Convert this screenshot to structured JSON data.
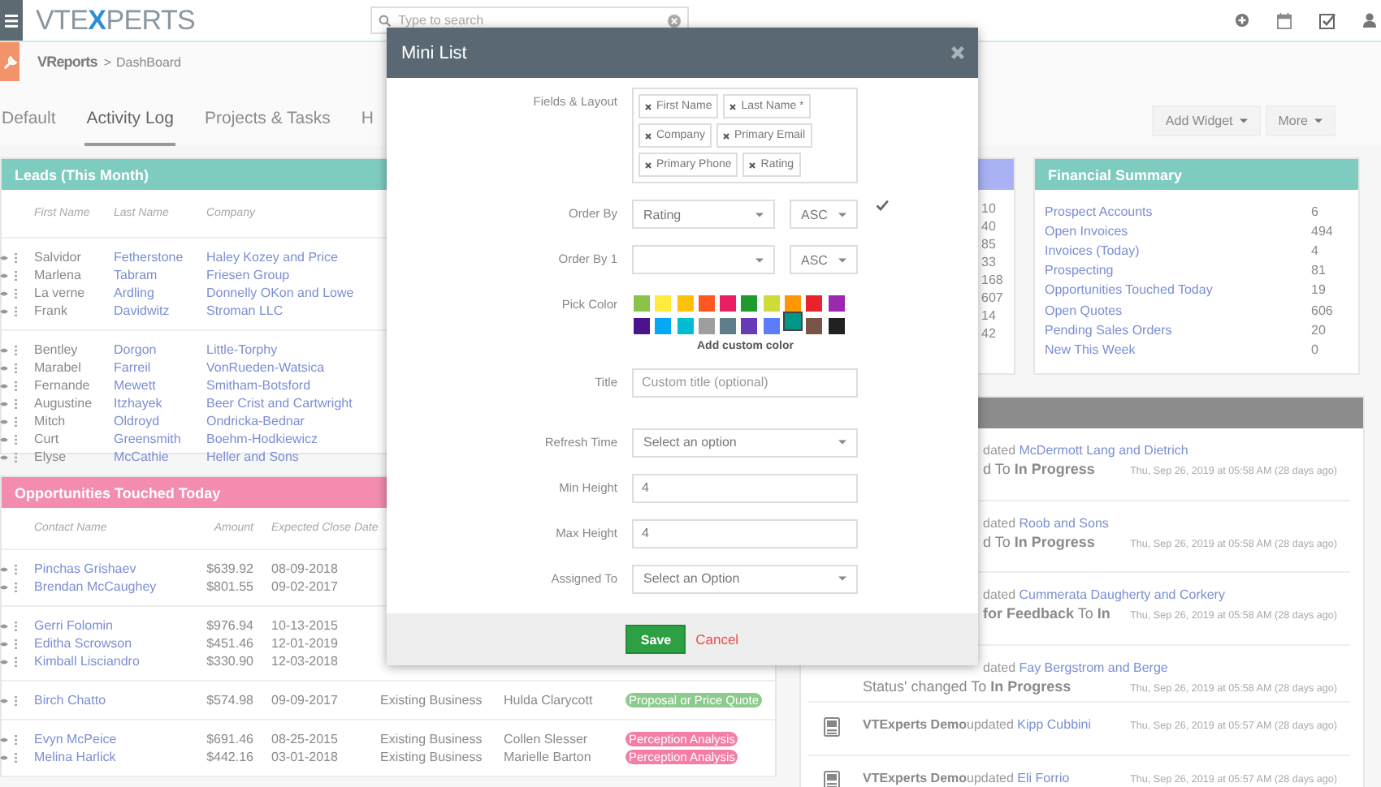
{
  "topbar": {
    "logo": [
      "VTE",
      "X",
      "PERTS"
    ],
    "search": {
      "placeholder": "Type to search"
    }
  },
  "breadcrumb": {
    "app": "VReports",
    "separator": ">",
    "page": "DashBoard"
  },
  "tabs": [
    {
      "label": "Default",
      "selected": false
    },
    {
      "label": "Activity Log",
      "selected": true
    },
    {
      "label": "Projects & Tasks",
      "selected": false
    },
    {
      "label": "H",
      "selected": false
    }
  ],
  "actions": [
    "Add Widget",
    "More"
  ],
  "leads": {
    "title": "Leads (This Month)",
    "columns": [
      "First Name",
      "Last Name",
      "Company"
    ],
    "groups": [
      [
        {
          "first": "Salvidor",
          "last": "Fetherstone",
          "company": "Haley Kozey and Price"
        },
        {
          "first": "Marlena",
          "last": "Tabram",
          "company": "Friesen Group"
        },
        {
          "first": "La verne",
          "last": "Ardling",
          "company": "Donnelly OKon and Lowe"
        },
        {
          "first": "Frank",
          "last": "Davidwitz",
          "company": "Stroman LLC"
        }
      ],
      [
        {
          "first": "Bentley",
          "last": "Dorgon",
          "company": "Little-Torphy"
        },
        {
          "first": "Marabel",
          "last": "Farreil",
          "company": "VonRueden-Watsica"
        },
        {
          "first": "Fernande",
          "last": "Mewett",
          "company": "Smitham-Botsford"
        },
        {
          "first": "Augustine",
          "last": "Itzhayek",
          "company": "Beer Crist and Cartwright"
        },
        {
          "first": "Mitch",
          "last": "Oldroyd",
          "company": "Ondricka-Bednar"
        },
        {
          "first": "Curt",
          "last": "Greensmith",
          "company": "Boehm-Hodkiewicz"
        },
        {
          "first": "Elyse",
          "last": "McCathie",
          "company": "Heller and Sons"
        }
      ]
    ]
  },
  "counts": [
    "10",
    "40",
    "85",
    "33",
    "168",
    "607",
    "14",
    "42"
  ],
  "financial": {
    "title": "Financial Summary",
    "rows": [
      {
        "label": "Prospect Accounts",
        "value": "6"
      },
      {
        "label": "Open Invoices",
        "value": "494"
      },
      {
        "label": "Invoices (Today)",
        "value": "4"
      },
      {
        "label": "Prospecting",
        "value": "81"
      },
      {
        "label": "Opportunities Touched Today",
        "value": "19"
      },
      {
        "label": "Open Quotes",
        "value": "606"
      },
      {
        "label": "Pending Sales Orders",
        "value": "20"
      },
      {
        "label": "New This Week",
        "value": "0"
      }
    ]
  },
  "opportunities": {
    "title": "Opportunities Touched Today",
    "columns": [
      "Contact Name",
      "Amount",
      "Expected Close Date"
    ],
    "groups": [
      [
        {
          "contact": "Pinchas Grishaev",
          "amount": "$639.92",
          "date": "08-09-2018"
        },
        {
          "contact": "Brendan McCaughey",
          "amount": "$801.55",
          "date": "09-02-2017"
        }
      ],
      [
        {
          "contact": "Gerri Folomin",
          "amount": "$976.94",
          "date": "10-13-2015"
        },
        {
          "contact": "Editha Scrowson",
          "amount": "$451.46",
          "date": "12-01-2019"
        },
        {
          "contact": "Kimball Lisciandro",
          "amount": "$330.90",
          "date": "12-03-2018"
        }
      ],
      [
        {
          "contact": "Birch Chatto",
          "amount": "$574.98",
          "date": "09-09-2017",
          "type": "Existing Business",
          "owner": "Hulda Clarycott",
          "stage": "Proposal or Price Quote",
          "color": "#8ccb8c"
        }
      ],
      [
        {
          "contact": "Evyn McPeice",
          "amount": "$691.46",
          "date": "08-25-2015",
          "type": "Existing Business",
          "owner": "Collen Slesser",
          "stage": "Perception Analysis",
          "color": "#f47ea6"
        },
        {
          "contact": "Melina Harlick",
          "amount": "$442.16",
          "date": "03-01-2018",
          "type": "Existing Business",
          "owner": "Marielle Barton",
          "stage": "Perception Analysis",
          "color": "#f47ea6"
        }
      ]
    ]
  },
  "activity": [
    {
      "kind": "covered",
      "verb": "dated",
      "target": "McDermott Lang and Dietrich",
      "detail": "d To **In Progress**",
      "time": "Thu, Sep 26, 2019 at 05:58 AM (28 days ago)"
    },
    {
      "kind": "covered",
      "verb": "dated",
      "target": "Roob and Sons",
      "detail": "d To **In Progress**",
      "time": "Thu, Sep 26, 2019 at 05:58 AM (28 days ago)"
    },
    {
      "kind": "covered",
      "verb": "dated",
      "target": "Cummerata Daugherty and Corkery",
      "detail": "**for Feedback** To **In**",
      "time": "Thu, Sep 26, 2019 at 05:58 AM (28 days ago)"
    },
    {
      "kind": "partial",
      "verb": "dated",
      "target": "Fay Bergstrom and Berge",
      "detail": "Status' changed To **In Progress**",
      "time": "Thu, Sep 26, 2019 at 05:58 AM (28 days ago)"
    },
    {
      "kind": "full",
      "actor": "VTExperts Demo",
      "verb": "updated",
      "target": "Kipp Cubbini",
      "time": "Thu, Sep 26, 2019 at 05:57 AM (28 days ago)"
    },
    {
      "kind": "full",
      "actor": "VTExperts Demo",
      "verb": "updated",
      "target": "Eli Forrio",
      "time": "Thu, Sep 26, 2019 at 05:57 AM (28 days ago)"
    }
  ],
  "modal": {
    "title": "Mini List",
    "fields": [
      {
        "kind": "tags",
        "label": "Fields & Layout",
        "tags": [
          "First Name",
          "Last Name *",
          "Company",
          "Primary Email",
          "Primary Phone",
          "Rating"
        ]
      },
      {
        "kind": "order",
        "label": "Order By",
        "value": "Rating",
        "direction": "ASC",
        "checked": true
      },
      {
        "kind": "order",
        "label": "Order By 1",
        "direction": "ASC"
      },
      {
        "kind": "colors",
        "label": "Pick Color",
        "link": "Add custom color",
        "swatches": [
          {
            "color": "#8bc34a",
            "selected": false
          },
          {
            "color": "#ffeb3b",
            "selected": false
          },
          {
            "color": "#ffc107",
            "selected": false
          },
          {
            "color": "#ff5722",
            "selected": false
          },
          {
            "color": "#e91e63",
            "selected": false
          },
          {
            "color": "#1e9a2e",
            "selected": false
          },
          {
            "color": "#cddc39",
            "selected": false
          },
          {
            "color": "#ff9800",
            "selected": false
          },
          {
            "color": "#e8232e",
            "selected": false
          },
          {
            "color": "#9c27b0",
            "selected": false
          },
          {
            "color": "#4a148c",
            "selected": false
          },
          {
            "color": "#03a9f4",
            "selected": false
          },
          {
            "color": "#00bcd4",
            "selected": false
          },
          {
            "color": "#9e9e9e",
            "selected": false
          },
          {
            "color": "#607d8b",
            "selected": false
          },
          {
            "color": "#673ab7",
            "selected": false
          },
          {
            "color": "#5c7cfa",
            "selected": false
          },
          {
            "color": "#009688",
            "selected": true
          },
          {
            "color": "#795548",
            "selected": false
          },
          {
            "color": "#212121",
            "selected": false
          }
        ]
      },
      {
        "kind": "text",
        "label": "Title",
        "placeholder": "Custom title (optional)"
      },
      {
        "kind": "select",
        "label": "Refresh Time",
        "value": "Select an option"
      },
      {
        "kind": "text",
        "label": "Min Height",
        "value": "4"
      },
      {
        "kind": "text",
        "label": "Max Height",
        "value": "4"
      },
      {
        "kind": "select",
        "label": "Assigned To",
        "value": "Select an Option"
      }
    ],
    "save": "Save",
    "cancel": "Cancel"
  }
}
